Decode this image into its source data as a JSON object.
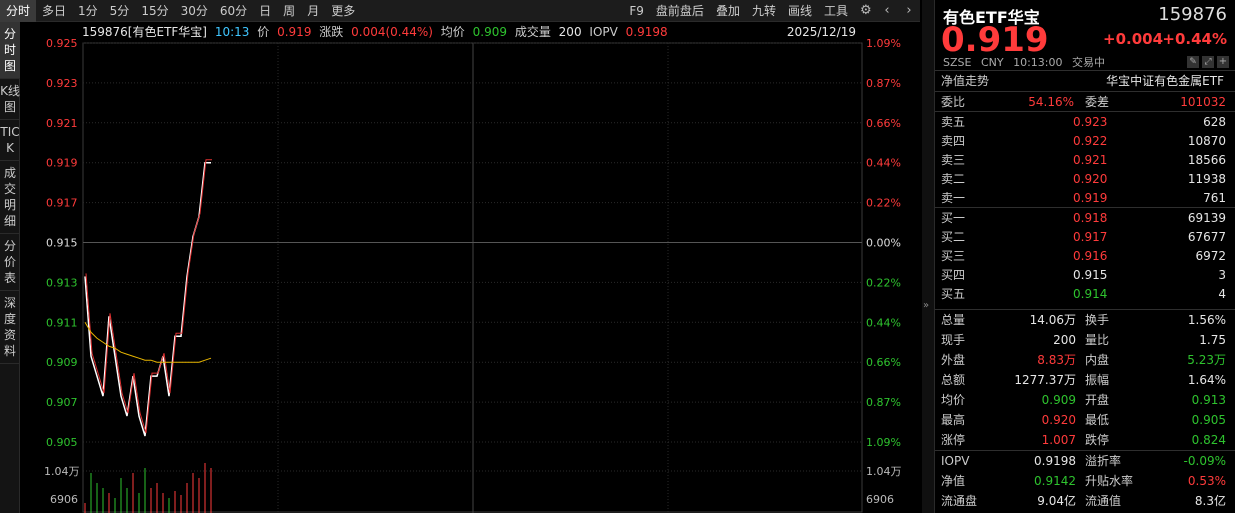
{
  "toolbar": {
    "tabs": [
      "分时",
      "多日",
      "1分",
      "5分",
      "15分",
      "30分",
      "60分",
      "日",
      "周",
      "月",
      "更多"
    ],
    "right": [
      "F9",
      "盘前盘后",
      "叠加",
      "九转",
      "画线",
      "工具"
    ]
  },
  "left_tabs": [
    "分时图",
    "K线图",
    "TICK",
    "成交明细",
    "分价表",
    "深度资料"
  ],
  "info": {
    "symbol": "159876[有色ETF华宝]",
    "time": "10:13",
    "price_label": "价",
    "price": "0.919",
    "chg_label": "涨跌",
    "chg": "0.004(0.44%)",
    "avg_label": "均价",
    "avg": "0.909",
    "vol_label": "成交量",
    "vol": "200",
    "iopv_label": "IOPV",
    "iopv": "0.9198",
    "date": "2025/12/19"
  },
  "chart_data": {
    "type": "line",
    "y_left": [
      "0.925",
      "0.923",
      "0.921",
      "0.919",
      "0.917",
      "0.915",
      "0.913",
      "0.911",
      "0.909",
      "0.907",
      "0.905"
    ],
    "y_right": [
      "1.09%",
      "0.87%",
      "0.66%",
      "0.44%",
      "0.22%",
      "0.00%",
      "0.22%",
      "0.44%",
      "0.66%",
      "0.87%",
      "1.09%"
    ],
    "ylim": [
      0.905,
      0.925
    ],
    "vol_labels": [
      "1.04万",
      "6906"
    ],
    "price_series": [
      0.9133,
      0.9093,
      0.9083,
      0.9073,
      0.9113,
      0.9093,
      0.9073,
      0.9063,
      0.9083,
      0.9063,
      0.9053,
      0.9083,
      0.9083,
      0.9093,
      0.9073,
      0.9103,
      0.9103,
      0.9133,
      0.9153,
      0.9163,
      0.919,
      0.919
    ],
    "avg_series": [
      0.911,
      0.9105,
      0.9102,
      0.91,
      0.9098,
      0.9097,
      0.9095,
      0.9094,
      0.9093,
      0.9092,
      0.9091,
      0.9091,
      0.909,
      0.909,
      0.909,
      0.909,
      0.909,
      0.909,
      0.909,
      0.909,
      0.9091,
      0.9092
    ]
  },
  "panel": {
    "name": "有色ETF华宝",
    "code": "159876",
    "price": "0.919",
    "chg": "+0.004",
    "pct": "+0.44%",
    "meta": [
      "SZSE",
      "CNY",
      "10:13:00",
      "交易中"
    ],
    "nav_label": "净值走势",
    "fund_name": "华宝中证有色金属ETF",
    "weibi_label": "委比",
    "weibi": "54.16%",
    "weicha_label": "委差",
    "weicha": "101032",
    "asks": [
      {
        "label": "卖五",
        "price": "0.923",
        "vol": "628"
      },
      {
        "label": "卖四",
        "price": "0.922",
        "vol": "10870"
      },
      {
        "label": "卖三",
        "price": "0.921",
        "vol": "18566"
      },
      {
        "label": "卖二",
        "price": "0.920",
        "vol": "11938"
      },
      {
        "label": "卖一",
        "price": "0.919",
        "vol": "761"
      }
    ],
    "bids": [
      {
        "label": "买一",
        "price": "0.918",
        "vol": "69139",
        "color": "red"
      },
      {
        "label": "买二",
        "price": "0.917",
        "vol": "67677",
        "color": "red"
      },
      {
        "label": "买三",
        "price": "0.916",
        "vol": "6972",
        "color": "red"
      },
      {
        "label": "买四",
        "price": "0.915",
        "vol": "3",
        "color": "white"
      },
      {
        "label": "买五",
        "price": "0.914",
        "vol": "4",
        "color": "green"
      }
    ],
    "stats": [
      {
        "l1": "总量",
        "v1": "14.06万",
        "c1": "white",
        "l2": "换手",
        "v2": "1.56%",
        "c2": "white"
      },
      {
        "l1": "现手",
        "v1": "200",
        "c1": "white",
        "l2": "量比",
        "v2": "1.75",
        "c2": "white"
      },
      {
        "l1": "外盘",
        "v1": "8.83万",
        "c1": "red",
        "l2": "内盘",
        "v2": "5.23万",
        "c2": "green"
      },
      {
        "l1": "总额",
        "v1": "1277.37万",
        "c1": "white",
        "l2": "振幅",
        "v2": "1.64%",
        "c2": "white"
      },
      {
        "l1": "均价",
        "v1": "0.909",
        "c1": "green",
        "l2": "开盘",
        "v2": "0.913",
        "c2": "green"
      },
      {
        "l1": "最高",
        "v1": "0.920",
        "c1": "red",
        "l2": "最低",
        "v2": "0.905",
        "c2": "green"
      },
      {
        "l1": "涨停",
        "v1": "1.007",
        "c1": "red",
        "l2": "跌停",
        "v2": "0.824",
        "c2": "green"
      }
    ],
    "stats2": [
      {
        "l1": "IOPV",
        "v1": "0.9198",
        "c1": "white",
        "l2": "溢折率",
        "v2": "-0.09%",
        "c2": "green"
      },
      {
        "l1": "净值",
        "v1": "0.9142",
        "c1": "green",
        "l2": "升贴水率",
        "v2": "0.53%",
        "c2": "red"
      },
      {
        "l1": "流通盘",
        "v1": "9.04亿",
        "c1": "white",
        "l2": "流通值",
        "v2": "8.3亿",
        "c2": "white"
      }
    ]
  }
}
